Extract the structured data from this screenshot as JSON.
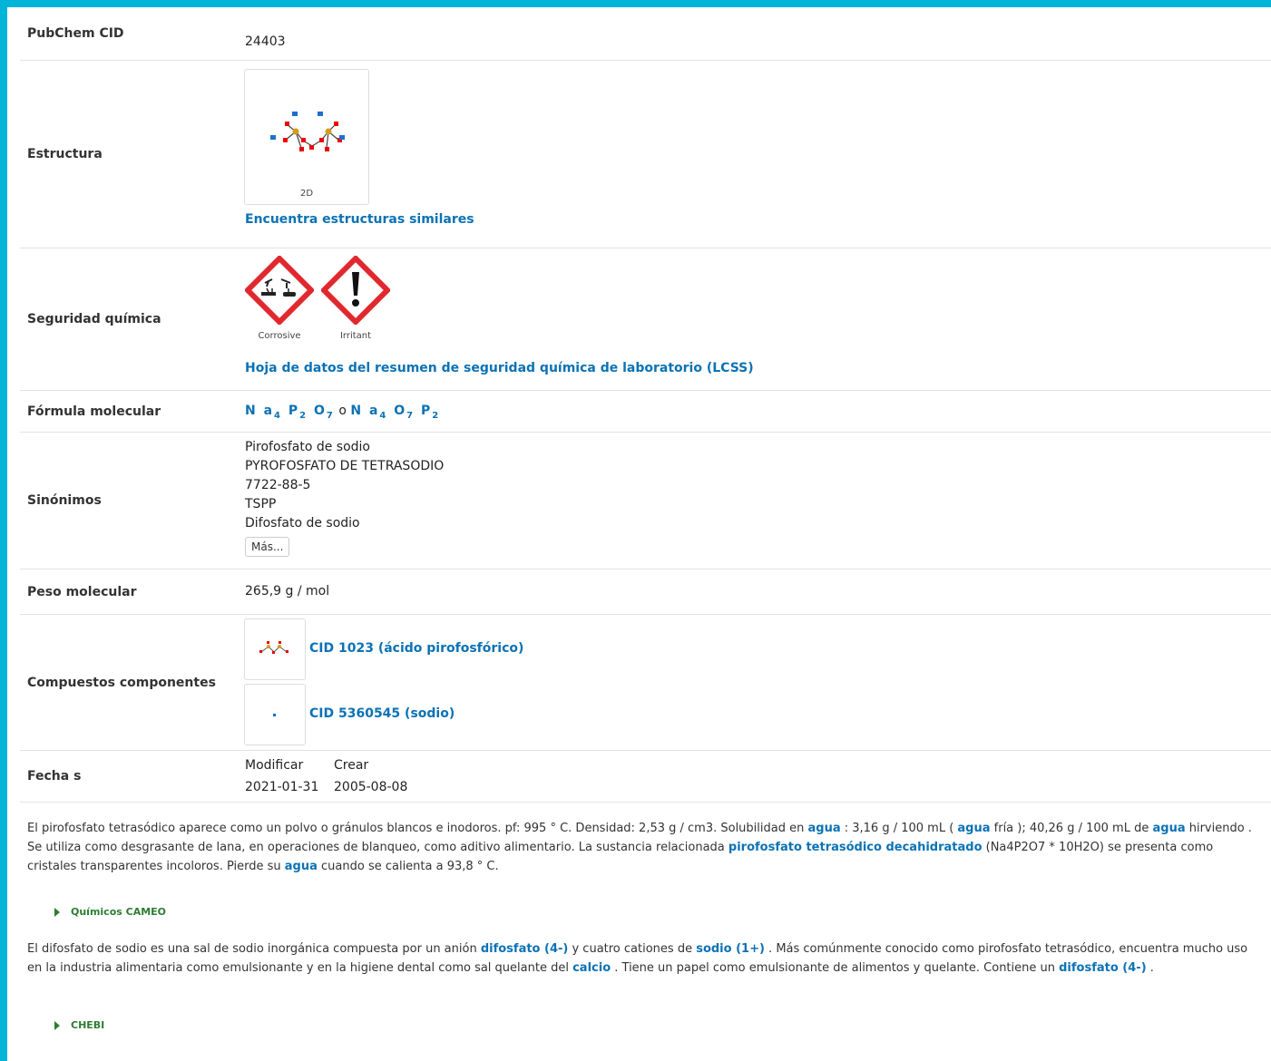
{
  "rows": {
    "cid": {
      "label": "PubChem CID",
      "value": "24403"
    },
    "structure": {
      "label": "Estructura",
      "thumb_caption": "2D",
      "link": "Encuentra estructuras similares"
    },
    "safety": {
      "label": "Seguridad química",
      "pictograms": [
        {
          "icon": "corrosive-icon",
          "caption": "Corrosive"
        },
        {
          "icon": "irritant-icon",
          "caption": "Irritant"
        }
      ],
      "link": "Hoja de datos del resumen de seguridad química de laboratorio (LCSS)"
    },
    "formula": {
      "label": "Fórmula molecular",
      "f1": {
        "a": "N a",
        "a_sub": "4",
        "b": "P",
        "b_sub": "2",
        "c": "O",
        "c_sub": "7"
      },
      "or": "o",
      "f2": {
        "a": "N a",
        "a_sub": "4",
        "b": "O",
        "b_sub": "7",
        "c": "P",
        "c_sub": "2"
      }
    },
    "synonyms": {
      "label": "Sinónimos",
      "items": [
        "Pirofosfato de sodio",
        "PYROFOSFATO DE TETRASODIO",
        "7722-88-5",
        "TSPP",
        "Difosfato de sodio"
      ],
      "more_button": "Más..."
    },
    "weight": {
      "label": "Peso molecular",
      "value": "265,9 g / mol"
    },
    "components": {
      "label": "Compuestos componentes",
      "items": [
        {
          "text": "CID 1023 (ácido pirofosfórico)"
        },
        {
          "text": "CID 5360545 (sodio)"
        }
      ]
    },
    "dates": {
      "label": "Fecha s",
      "modify_header": "Modificar",
      "create_header": "Crear",
      "modify_value": "2021-01-31",
      "create_value": "2005-08-08"
    }
  },
  "description1": {
    "t1": "El pirofosfato tetrasódico aparece como un polvo o gránulos blancos e inodoros. pf: 995 ° C. Densidad: 2,53 g / cm3. Solubilidad en ",
    "l1": "agua",
    "t2": " : 3,16 g / 100 mL ( ",
    "l2": "agua",
    "t3": " fría ); 40,26 g / 100 mL de ",
    "l3": "agua",
    "t4": " hirviendo . Se utiliza como desgrasante de lana, en operaciones de blanqueo, como aditivo alimentario. La sustancia relacionada ",
    "l4": "pirofosfato tetrasódico decahidratado",
    "t5": " (Na4P2O7 * 10H2O) se presenta como cristales transparentes incoloros. Pierde su ",
    "l5": "agua",
    "t6": " cuando se calienta a 93,8 ° C.",
    "source": "Químicos CAMEO"
  },
  "description2": {
    "t1": "El difosfato de sodio es una sal de sodio inorgánica compuesta por un anión ",
    "l1": "difosfato (4-)",
    "t2": " y cuatro cationes de ",
    "l2": "sodio (1+)",
    "t3": " . Más comúnmente conocido como pirofosfato tetrasódico, encuentra mucho uso en la industria alimentaria como emulsionante y en la higiene dental como sal quelante del ",
    "l3": "calcio",
    "t4": " . Tiene un papel como emulsionante de alimentos y quelante. Contiene un ",
    "l4": "difosfato (4-)",
    "t5": " .",
    "source": "CHEBI"
  },
  "colors": {
    "accent": "#00b4d8",
    "link": "#0b72b5",
    "source": "#2e7d32",
    "hazard_red": "#e0282e"
  }
}
